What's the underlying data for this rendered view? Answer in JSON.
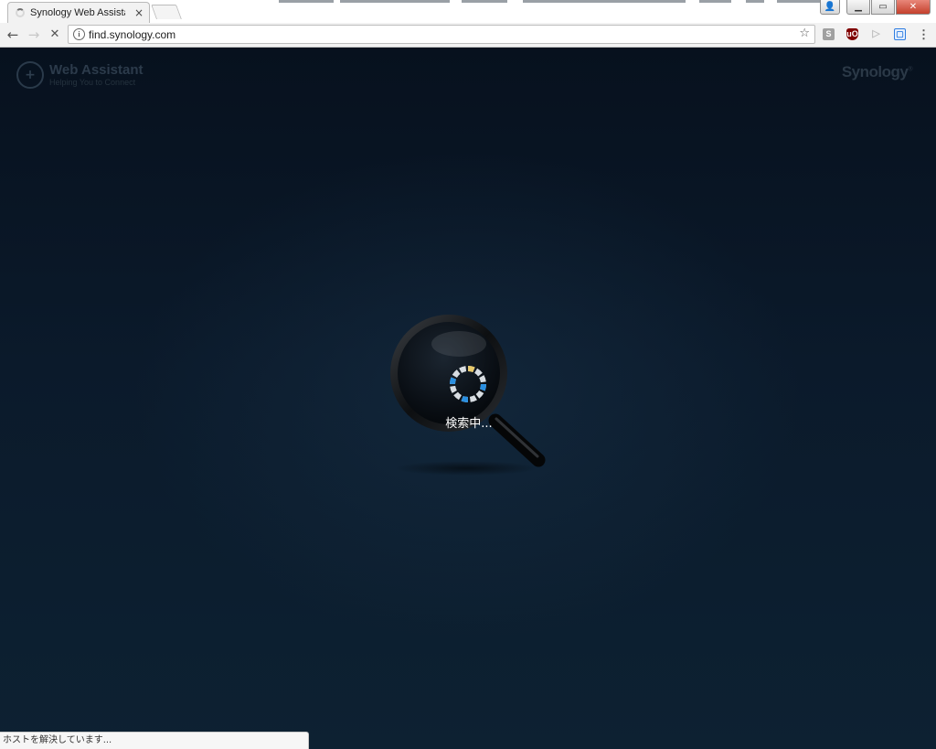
{
  "browser": {
    "tab_title": "Synology Web Assistant",
    "tab_close": "×",
    "url": "find.synology.com",
    "nav": {
      "back": "←",
      "forward": "→",
      "stop": "✕"
    },
    "star": "☆",
    "extensions": {
      "s_label": "S",
      "ublock_label": "uO",
      "arrow_label": "▷",
      "blue_label": "▢",
      "menu_label": "⋮"
    },
    "window_controls": {
      "profile": "👤",
      "minimize": "▁",
      "maximize": "▭",
      "close": "✕"
    }
  },
  "page": {
    "logo_title": "Web Assistant",
    "logo_subtitle": "Helping You to Connect",
    "logo_glyph": "+",
    "brand": "Synology",
    "brand_mark": "®",
    "searching_label": "検索中..."
  },
  "status_bar": {
    "text": "ホストを解決しています..."
  },
  "colors": {
    "spinner_blue": "#2a8fe0",
    "spinner_yellow": "#e8c96a",
    "spinner_gray": "#d8dde2"
  },
  "icons": [
    "back-arrow-icon",
    "forward-arrow-icon",
    "stop-icon",
    "info-icon",
    "star-icon",
    "magnifier-icon",
    "loading-spinner-icon"
  ]
}
